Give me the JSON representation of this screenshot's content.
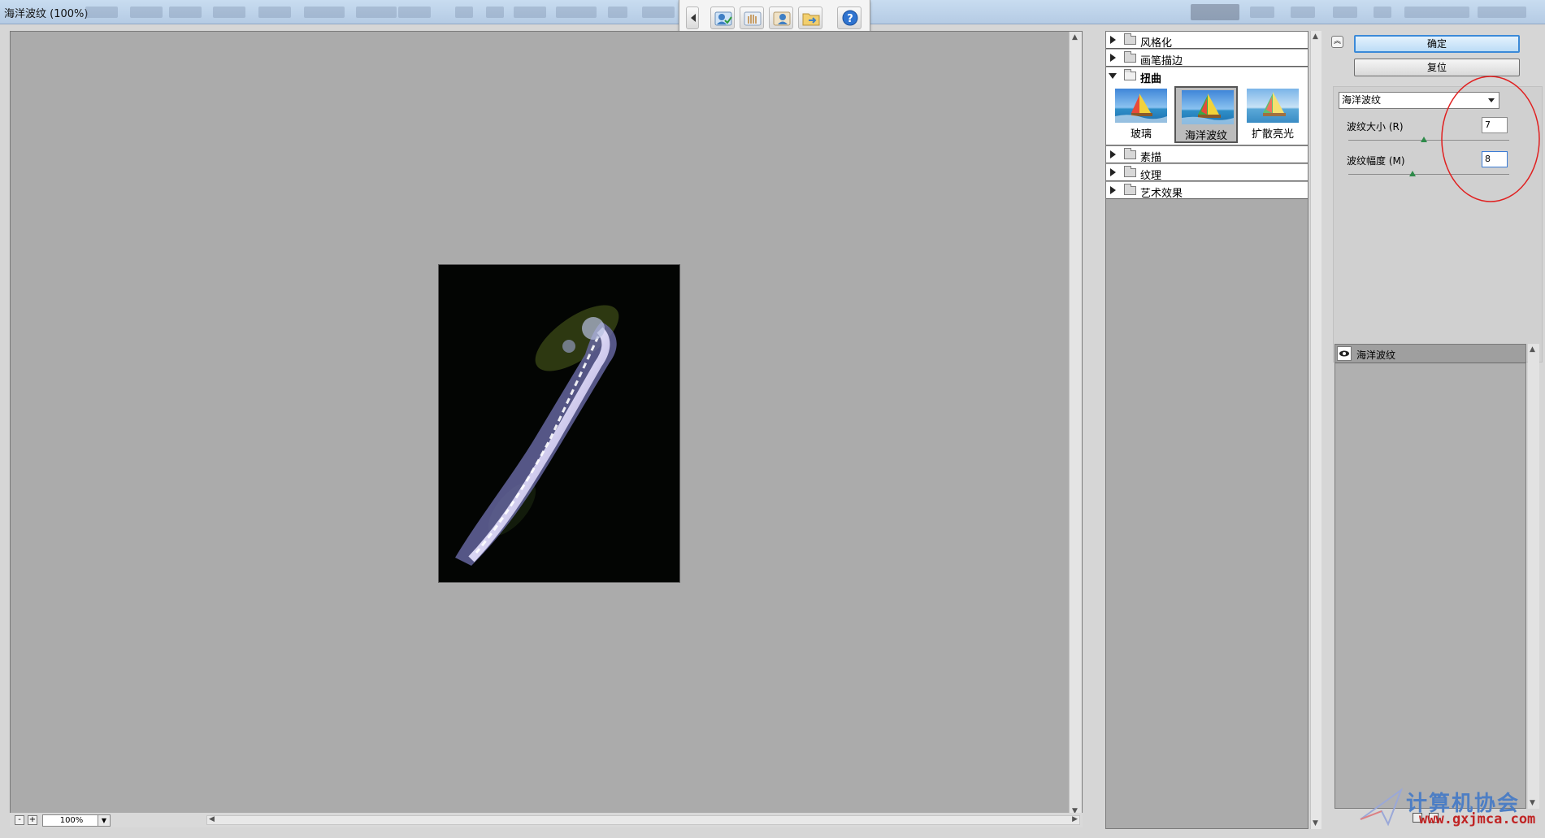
{
  "window": {
    "title": "海洋波纹 (100%)"
  },
  "toolbar": {
    "icons": [
      "arrow-left-icon",
      "user-check-icon",
      "hand-icon",
      "user-icon",
      "folder-arrow-icon",
      "help-icon"
    ],
    "help_label": "?"
  },
  "preview": {
    "zoom_value": "100%",
    "zoom_out_label": "-",
    "zoom_in_label": "+"
  },
  "gallery": {
    "categories": [
      {
        "label": "风格化",
        "expanded": false
      },
      {
        "label": "画笔描边",
        "expanded": false
      },
      {
        "label": "扭曲",
        "expanded": true
      },
      {
        "label": "素描",
        "expanded": false
      },
      {
        "label": "纹理",
        "expanded": false
      },
      {
        "label": "艺术效果",
        "expanded": false
      }
    ],
    "filters": [
      {
        "label": "玻璃",
        "selected": false
      },
      {
        "label": "海洋波纹",
        "selected": true
      },
      {
        "label": "扩散亮光",
        "selected": false
      }
    ]
  },
  "panel": {
    "ok_label": "确定",
    "reset_label": "复位",
    "filter_select": "海洋波纹",
    "params": [
      {
        "label": "波纹大小 (R)",
        "value": "7",
        "fraction": 0.47
      },
      {
        "label": "波纹幅度 (M)",
        "value": "8",
        "fraction": 0.4
      }
    ]
  },
  "layers": {
    "items": [
      {
        "name": "海洋波纹",
        "visible": true
      }
    ]
  },
  "watermark": {
    "text": "计算机协会",
    "url": "www.gxjmca.com"
  },
  "colors": {
    "accent": "#3b8ad8",
    "annotation_circle": "#e02020",
    "preview_bg": "#ababab"
  }
}
